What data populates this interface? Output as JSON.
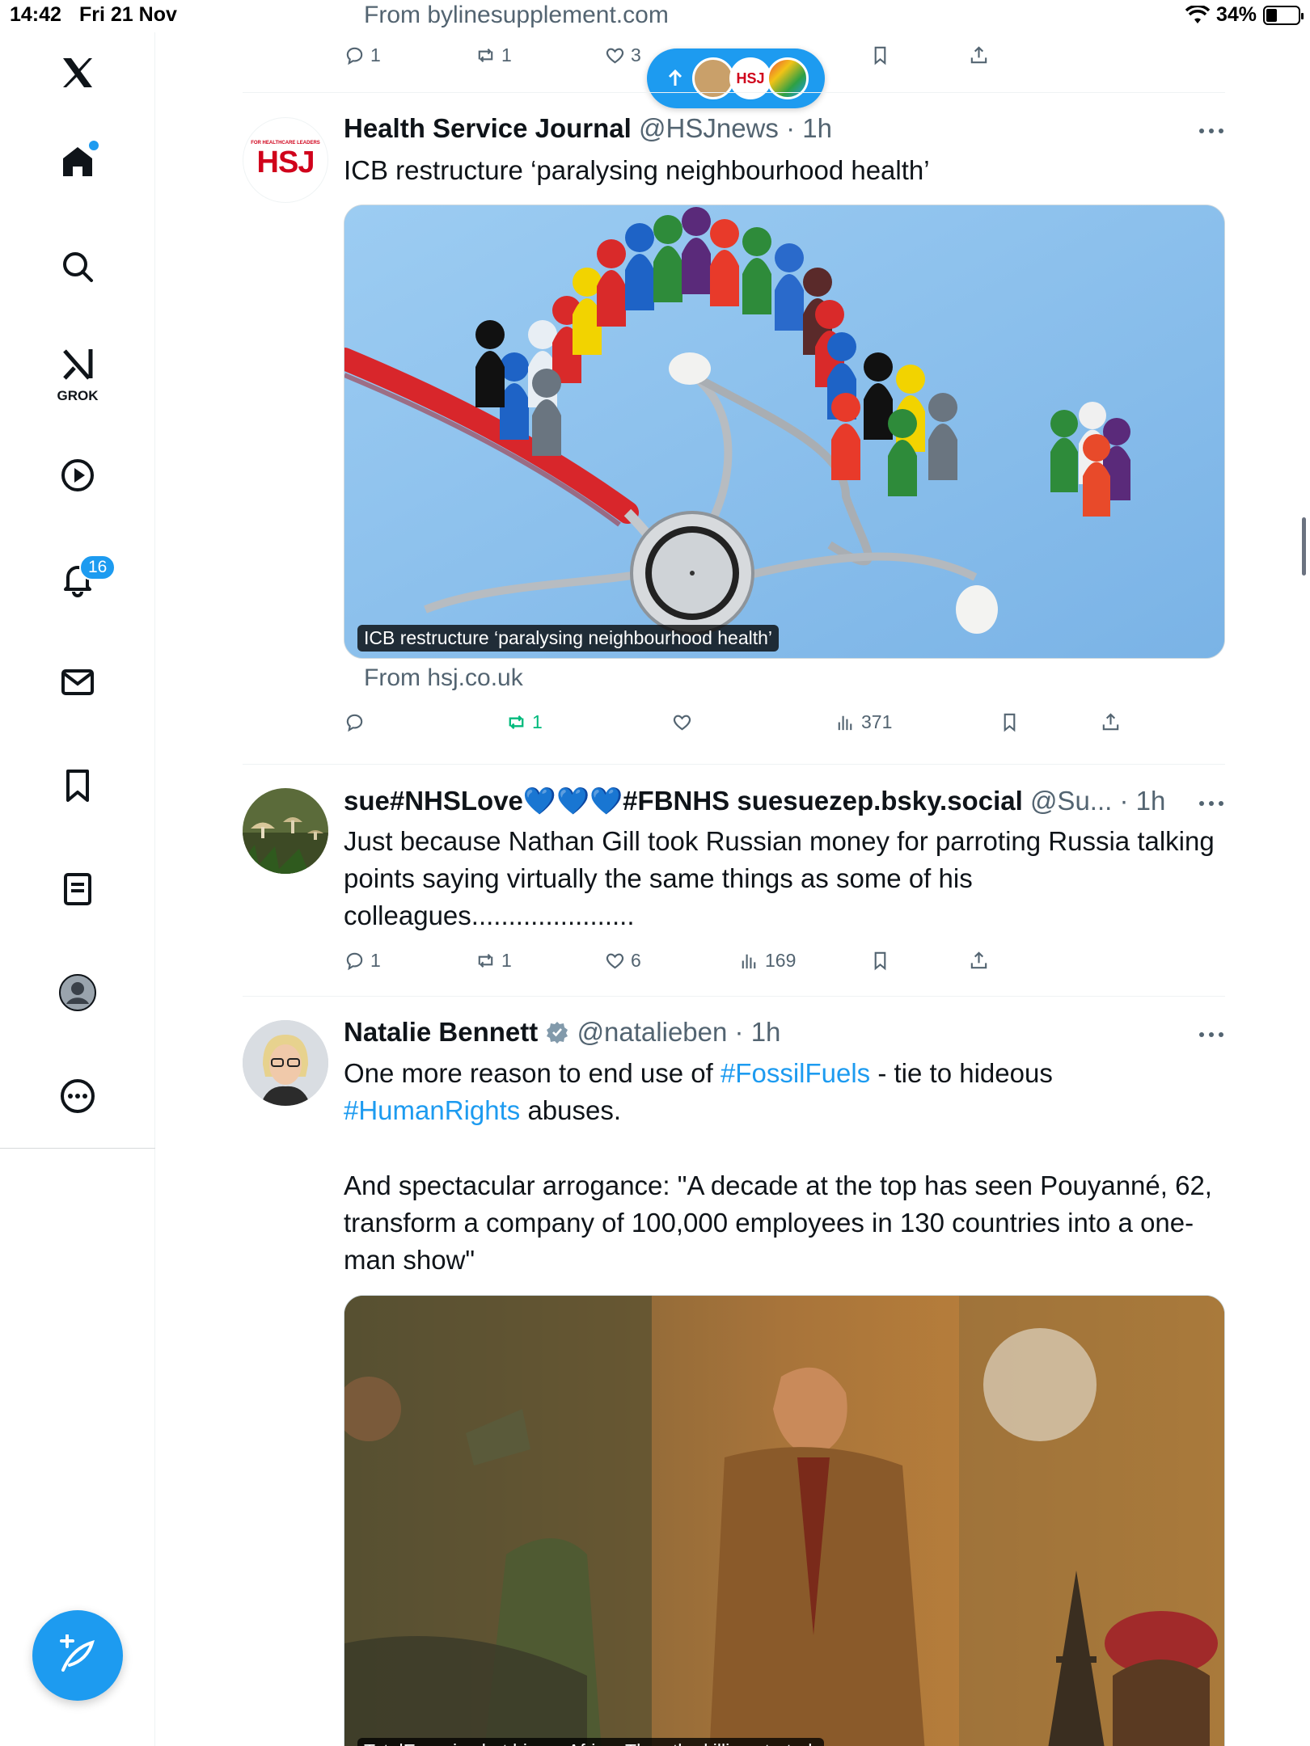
{
  "status": {
    "time": "14:42",
    "date": "Fri 21 Nov",
    "battery": "34%"
  },
  "sidebar": {
    "notifications_count": "16",
    "grok_label": "GROK"
  },
  "top_tweet": {
    "from": "From bylinesupplement.com",
    "replies": "1",
    "reposts": "1",
    "likes": "3"
  },
  "tweets": [
    {
      "name": "Health Service Journal",
      "handle": "@HSJnews",
      "time": "· 1h",
      "avatar_text": "HSJ",
      "avatar_small": "FOR HEALTHCARE LEADERS",
      "text": "ICB restructure ‘paralysing neighbourhood health’",
      "media_caption": "ICB restructure ‘paralysing neighbourhood health’",
      "from": "From hsj.co.uk",
      "replies": "",
      "reposts": "1",
      "likes": "",
      "views": "371"
    },
    {
      "name": "sue#NHSLove💙💙💙#FBNHS suesuezep.bsky.social",
      "handle": "@Su...",
      "time": "· 1h",
      "text": "Just because Nathan Gill took Russian money for parroting Russia talking points saying virtually the same things as some of his colleagues......................",
      "replies": "1",
      "reposts": "1",
      "likes": "6",
      "views": "169"
    },
    {
      "name": "Natalie Bennett",
      "handle": "@natalieben",
      "time": "· 1h",
      "text_a": "One more reason to end use of ",
      "hashtag_1": "#FossilFuels",
      "text_b": " - tie to hideous ",
      "hashtag_2": "#HumanRights",
      "text_c": " abuses.",
      "text_d": "And spectacular arrogance: \"A decade at the top has seen Pouyanné, 62, transform a company of 100,000 employees in 130 countries into a one-man show\"",
      "media_caption": "TotalEnergies bet big on Africa. Then the killing started."
    }
  ],
  "colors": {
    "accent": "#1d9bf0",
    "repost_active": "#00ba7c",
    "muted": "#536471"
  }
}
